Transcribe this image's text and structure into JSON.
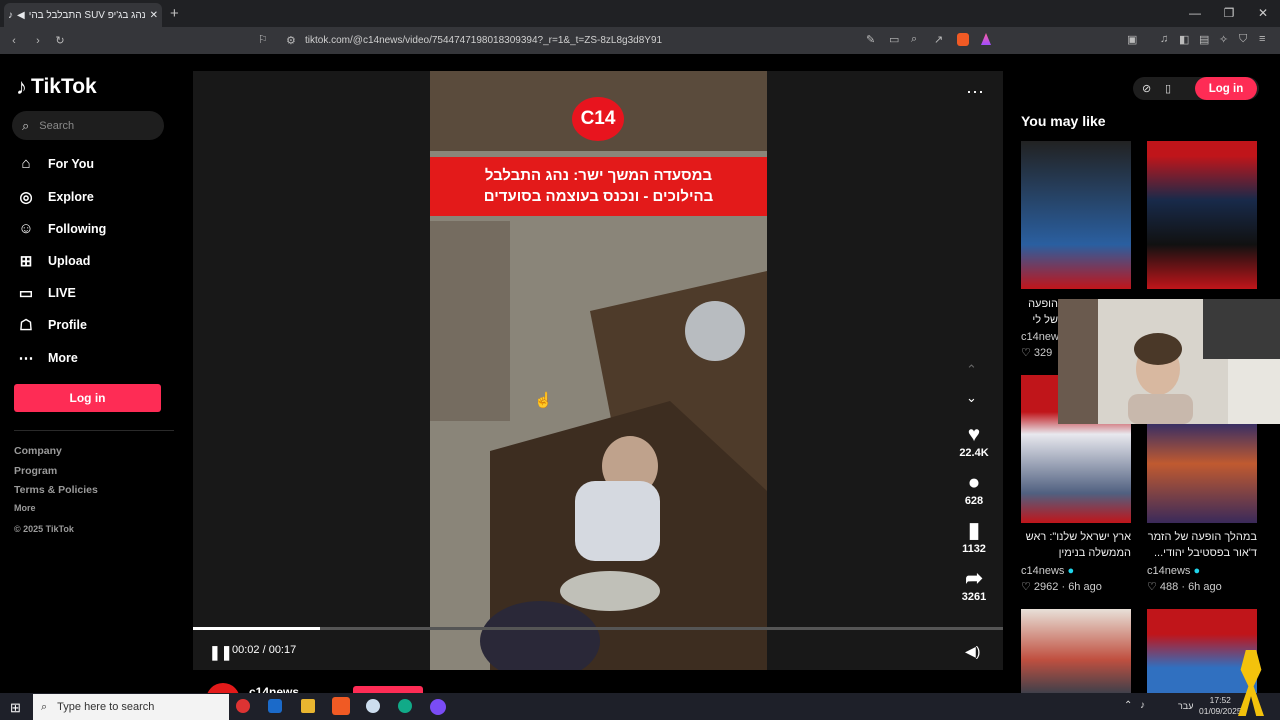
{
  "browser": {
    "tab_title": "נהג בג'יפ SUV התבלבל בהיל",
    "url": "tiktok.com/@c14news/video/7544747198018309394?_r=1&_t=ZS-8zL8g3d8Y91"
  },
  "tiktok": {
    "logo": "TikTok",
    "search_placeholder": "Search",
    "nav": [
      {
        "label": "For You",
        "icon": "home-icon"
      },
      {
        "label": "Explore",
        "icon": "compass-icon"
      },
      {
        "label": "Following",
        "icon": "users-icon"
      },
      {
        "label": "Upload",
        "icon": "plus-square-icon"
      },
      {
        "label": "LIVE",
        "icon": "live-tv-icon"
      },
      {
        "label": "Profile",
        "icon": "person-icon"
      },
      {
        "label": "More",
        "icon": "more-dots-icon"
      }
    ],
    "login_label": "Log in",
    "footer": [
      "Company",
      "Program",
      "Terms & Policies",
      "More",
      "© 2025 TikTok"
    ]
  },
  "video": {
    "channel_logo": "C14",
    "headline_line1": "במסעדה המשך ישר: נהג התבלבל",
    "headline_line2": "בהילוכים - ונכנס בעוצמה בסועדים",
    "time": "00:02 / 00:17",
    "progress": 0.157,
    "likes": "22.4K",
    "comments": "628",
    "saves": "1132",
    "shares": "3261",
    "account": "c14news"
  },
  "right": {
    "title": "You may like",
    "login_label": "Log in",
    "items": [
      {
        "caption": "הופעה של לי העלה",
        "account": "c14news",
        "likes": "329",
        "time": ""
      },
      {
        "caption": "",
        "account": "",
        "likes": "",
        "time": ""
      },
      {
        "caption": "ארץ ישראל שלנו\": ראש הממשלה בנימין נתניהו...",
        "account": "c14news",
        "likes": "2962",
        "time": "6h ago"
      },
      {
        "caption": "במהלך הופעה של הזמר ד'אור בפסטיבל יהודי...",
        "account": "c14news",
        "likes": "488",
        "time": "6h ago"
      }
    ]
  },
  "taskbar": {
    "search_placeholder": "Type here to search",
    "lang": "עבר",
    "time": "17:52",
    "date": "01/09/2025"
  },
  "colors": {
    "accent": "#fe2c55",
    "brand_red": "#e31a1a"
  }
}
